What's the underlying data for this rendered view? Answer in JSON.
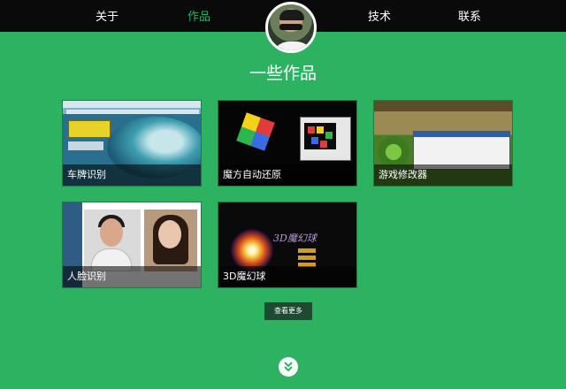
{
  "nav": {
    "items": [
      {
        "label": "关于"
      },
      {
        "label": "作品"
      },
      {
        "label": "技术"
      },
      {
        "label": "联系"
      }
    ],
    "active_index": 1
  },
  "section": {
    "title": "一些作品"
  },
  "works": [
    {
      "caption": "车牌识别"
    },
    {
      "caption": "魔方自动还原"
    },
    {
      "caption": "游戏修改器"
    },
    {
      "caption": "人脸识别"
    },
    {
      "caption": "3D魔幻球"
    }
  ],
  "more_button": {
    "label": "查看更多"
  },
  "thumb_text": {
    "magic_ball_logo": "3D魔幻球"
  },
  "icons": {
    "scroll_down": "double-chevron-down-icon",
    "avatar": "avatar"
  },
  "colors": {
    "background": "#2db261",
    "nav_bar": "#0a0a0a",
    "nav_active": "#2db261",
    "more_button": "#1f4a32"
  }
}
